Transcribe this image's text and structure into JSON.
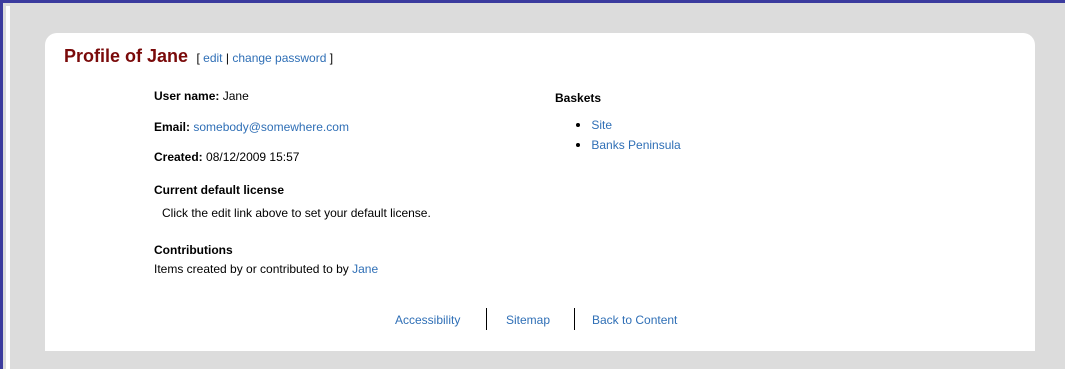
{
  "profile": {
    "title": "Profile of Jane",
    "links": {
      "open_bracket": "[",
      "edit": "edit",
      "divider": "|",
      "change_password": "change password",
      "close_bracket": "]"
    },
    "user_name_label": "User name:",
    "user_name_value": "Jane",
    "email_label": "Email:",
    "email_value": "somebody@somewhere.com",
    "created_label": "Created:",
    "created_value": "08/12/2009 15:57",
    "license_heading": "Current default license",
    "license_text": "Click the edit link above to set your default license.",
    "contributions_heading": "Contributions",
    "contributions_text": "Items created by or contributed to by",
    "contributions_link": "Jane"
  },
  "baskets": {
    "heading": "Baskets",
    "items": [
      {
        "label": "Site"
      },
      {
        "label": "Banks Peninsula"
      }
    ]
  },
  "footer": {
    "links": [
      {
        "label": "Accessibility"
      },
      {
        "label": "Sitemap"
      },
      {
        "label": "Back to Content"
      }
    ]
  },
  "colors": {
    "title": "#7a0a0a",
    "link": "#2f6fb6",
    "frame_border": "#3b3b9e",
    "background": "#dcdcdc"
  }
}
